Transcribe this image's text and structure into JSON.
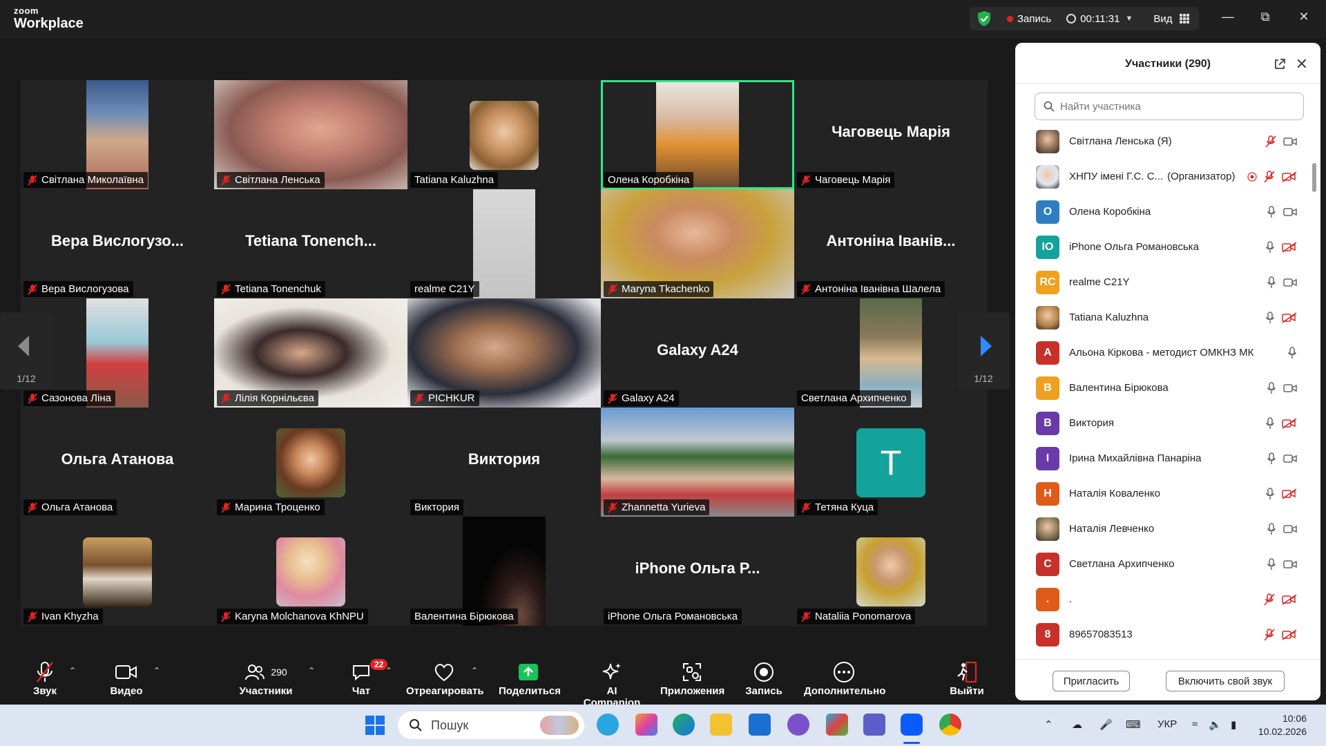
{
  "app": {
    "brand_top": "zoom",
    "brand_bottom": "Workplace"
  },
  "titlebar": {
    "record_label": "Запись",
    "timer": "00:11:31",
    "view_label": "Вид"
  },
  "gallery": {
    "page_left": "1/12",
    "page_right": "1/12",
    "tiles": [
      {
        "label": "Світлана Миколаївна",
        "muted": true,
        "big": ""
      },
      {
        "label": "Світлана Ленська",
        "muted": true,
        "big": ""
      },
      {
        "label": "Tatiana Kaluzhna",
        "muted": false,
        "big": ""
      },
      {
        "label": "Олена Коробкіна",
        "muted": false,
        "big": "",
        "active": true
      },
      {
        "label": "Чаговець Марія",
        "muted": true,
        "big": "Чаговець Марія"
      },
      {
        "label": "Вера Вислогузова",
        "muted": true,
        "big": "Вера  Вислогузо..."
      },
      {
        "label": "Tetiana Tonenchuk",
        "muted": true,
        "big": "Tetiana  Tonench..."
      },
      {
        "label": "realme C21Y",
        "muted": false,
        "big": ""
      },
      {
        "label": "Maryna Tkachenko",
        "muted": true,
        "big": ""
      },
      {
        "label": "Антоніна Іванівна Шалела",
        "muted": true,
        "big": "Антоніна Іванів..."
      },
      {
        "label": "Сазонова Ліна",
        "muted": true,
        "big": ""
      },
      {
        "label": "Лілія Корнільєва",
        "muted": true,
        "big": ""
      },
      {
        "label": "PICHKUR",
        "muted": true,
        "big": ""
      },
      {
        "label": "Galaxy A24",
        "muted": true,
        "big": "Galaxy A24"
      },
      {
        "label": "Светлана Архипченко",
        "muted": false,
        "big": ""
      },
      {
        "label": "Ольга Атанова",
        "muted": true,
        "big": "Ольга Атанова"
      },
      {
        "label": "Марина Троценко",
        "muted": true,
        "big": ""
      },
      {
        "label": "Виктория",
        "muted": false,
        "big": "Виктория"
      },
      {
        "label": "Zhannetta Yurieva",
        "muted": true,
        "big": ""
      },
      {
        "label": "Тетяна Куца",
        "muted": true,
        "big": ""
      },
      {
        "label": "Ivan Khyzha",
        "muted": true,
        "big": ""
      },
      {
        "label": "Karyna Molchanova KhNPU",
        "muted": true,
        "big": ""
      },
      {
        "label": "Валентина Бірюкова",
        "muted": false,
        "big": ""
      },
      {
        "label": "iPhone Ольга Романовська",
        "muted": false,
        "big": "iPhone Ольга  Р..."
      },
      {
        "label": "Nataliia Ponomarova",
        "muted": true,
        "big": ""
      }
    ],
    "letter_avatar": "T"
  },
  "panel": {
    "title": "Участники (290)",
    "search_placeholder": "Найти участника",
    "participants": [
      {
        "initials": "",
        "name": "Світлана Ленська (Я)",
        "extra": "",
        "color": "#8a6a55",
        "photo": true,
        "mic": "muted",
        "cam": "on"
      },
      {
        "initials": "",
        "name": "ХНПУ імені Г.С. С...",
        "extra": "(Организатор)",
        "color": "#dfe7f5",
        "photo": true,
        "mic": "muted",
        "cam": "off",
        "host": true
      },
      {
        "initials": "О",
        "name": "Олена Коробкіна",
        "extra": "",
        "color": "#2d7fc1",
        "photo": false,
        "mic": "on",
        "cam": "on"
      },
      {
        "initials": "IO",
        "name": "iPhone Ольга Романовська",
        "extra": "",
        "color": "#13a39a",
        "photo": false,
        "mic": "on",
        "cam": "off"
      },
      {
        "initials": "RC",
        "name": "realme C21Y",
        "extra": "",
        "color": "#f0a020",
        "photo": false,
        "mic": "on",
        "cam": "on"
      },
      {
        "initials": "",
        "name": "Tatiana Kaluzhna",
        "extra": "",
        "color": "#b7864a",
        "photo": true,
        "mic": "on",
        "cam": "off"
      },
      {
        "initials": "А",
        "name": "Альона Кіркова - методист ОМКНЗ МК",
        "extra": "",
        "color": "#c8302a",
        "photo": false,
        "mic": "on",
        "cam": "none"
      },
      {
        "initials": "В",
        "name": "Валентина Бірюкова",
        "extra": "",
        "color": "#f0a020",
        "photo": false,
        "mic": "on",
        "cam": "on"
      },
      {
        "initials": "В",
        "name": "Виктория",
        "extra": "",
        "color": "#6a3aa8",
        "photo": false,
        "mic": "on",
        "cam": "off"
      },
      {
        "initials": "І",
        "name": "Ірина Михайлівна Панаріна",
        "extra": "",
        "color": "#6a3aa8",
        "photo": false,
        "mic": "on",
        "cam": "on"
      },
      {
        "initials": "Н",
        "name": "Наталія Коваленко",
        "extra": "",
        "color": "#e05a1a",
        "photo": false,
        "mic": "on",
        "cam": "off"
      },
      {
        "initials": "",
        "name": "Наталія Левченко",
        "extra": "",
        "color": "#8a7a5a",
        "photo": true,
        "mic": "on",
        "cam": "on"
      },
      {
        "initials": "С",
        "name": "Светлана Архипченко",
        "extra": "",
        "color": "#c8302a",
        "photo": false,
        "mic": "on",
        "cam": "on"
      },
      {
        "initials": ".",
        "name": ".",
        "extra": "",
        "color": "#e05a1a",
        "photo": false,
        "mic": "muted",
        "cam": "off"
      },
      {
        "initials": "8",
        "name": "89657083513",
        "extra": "",
        "color": "#c8302a",
        "photo": false,
        "mic": "muted",
        "cam": "off"
      }
    ],
    "invite_button": "Пригласить",
    "unmute_button": "Включить свой звук"
  },
  "toolbar": {
    "audio": "Звук",
    "video": "Видео",
    "participants": "Участники",
    "participants_count": "290",
    "chat": "Чат",
    "chat_badge": "22",
    "react": "Отреагировать",
    "share": "Поделиться",
    "ai": "AI Companion",
    "apps": "Приложения",
    "record": "Запись",
    "more": "Дополнительно",
    "leave": "Выйти"
  },
  "taskbar": {
    "search": "Пошук",
    "lang": "УКР",
    "time": "10:06",
    "date": "10.02.2026"
  },
  "colors": {
    "active_speaker": "#2ee88a",
    "accent": "#0b5cff",
    "share_green": "#19c35b",
    "muted_red": "#e02424"
  }
}
